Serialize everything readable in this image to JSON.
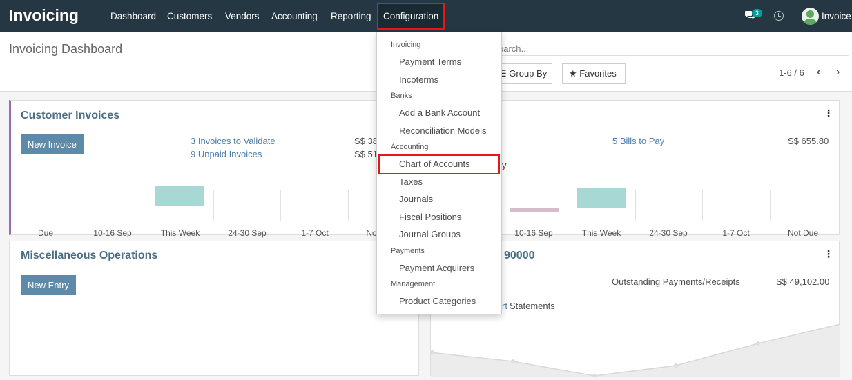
{
  "app": {
    "brand": "Invoicing"
  },
  "nav": {
    "items": [
      "Dashboard",
      "Customers",
      "Vendors",
      "Accounting",
      "Reporting"
    ],
    "active": "Configuration",
    "messages_badge": "3",
    "user": "Invoice"
  },
  "page": {
    "title": "Invoicing Dashboard",
    "search_placeholder": "earch...",
    "group_by": "Group By",
    "favorites": "Favorites",
    "pager": "1-6 / 6"
  },
  "customer_invoices": {
    "title": "Customer Invoices",
    "button": "New Invoice",
    "link1": "3 Invoices to Validate",
    "link2": "9 Unpaid Invoices",
    "amount1": "S$ 38",
    "amount2": "S$ 51",
    "graph": {
      "labels": [
        "Due",
        "10-16 Sep",
        "This Week",
        "24-30 Sep",
        "1-7 Oct",
        "No"
      ],
      "values": [
        0,
        0,
        1,
        0,
        0,
        0
      ]
    }
  },
  "vendor_bills": {
    "link": "5 Bills to Pay",
    "amount": "S$ 655.80",
    "partial_text": "y",
    "graph": {
      "labels": [
        "10-16 Sep",
        "This Week",
        "24-30 Sep",
        "1-7 Oct",
        "Not Due"
      ],
      "values": [
        0.3,
        1,
        0,
        0,
        0
      ]
    }
  },
  "misc_operations": {
    "title": "Miscellaneous Operations",
    "button": "New Entry"
  },
  "bank": {
    "title_partial": "90000",
    "outstanding_label": "Outstanding Payments/Receipts",
    "outstanding_amount": "S$ 49,102.00",
    "statements_link_partial": "rt",
    "statements_text": "Statements"
  },
  "dropdown": {
    "sections": [
      {
        "header": "Invoicing",
        "items": [
          "Payment Terms",
          "Incoterms"
        ]
      },
      {
        "header": "Banks",
        "items": [
          "Add a Bank Account",
          "Reconciliation Models"
        ]
      },
      {
        "header": "Accounting",
        "items": [
          "Chart of Accounts",
          "Taxes",
          "Journals",
          "Fiscal Positions",
          "Journal Groups"
        ]
      },
      {
        "header": "Payments",
        "items": [
          "Payment Acquirers"
        ]
      },
      {
        "header": "Management",
        "items": [
          "Product Categories"
        ]
      }
    ],
    "highlighted": "Chart of Accounts"
  },
  "colors": {
    "navbar": "#243742",
    "highlight": "#e8151b",
    "accent": "#5d8aa8",
    "bar_teal": "#a8d8d4",
    "bar_mauve": "#d5bcc8"
  }
}
